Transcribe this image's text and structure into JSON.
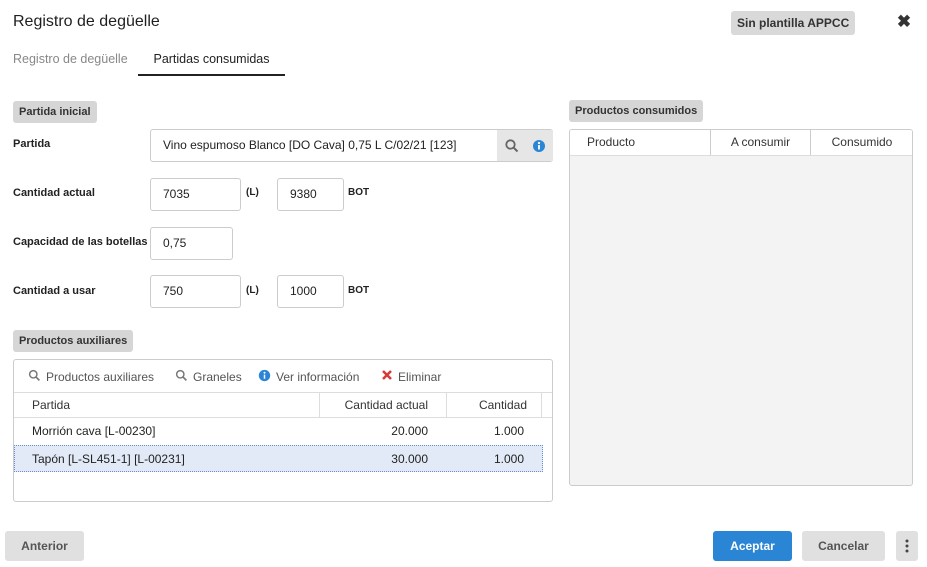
{
  "header": {
    "title": "Registro de degüelle",
    "template_badge": "Sin plantilla APPCC"
  },
  "tabs": [
    {
      "label": "Registro de degüelle"
    },
    {
      "label": "Partidas consumidas"
    }
  ],
  "partida_inicial": {
    "section_label": "Partida inicial",
    "partida_label": "Partida",
    "partida_value": "Vino espumoso Blanco [DO Cava] 0,75 L C/02/21 [123]",
    "cantidad_actual_label": "Cantidad actual",
    "cantidad_actual_l": "7035",
    "cantidad_actual_bot": "9380",
    "capacidad_label": "Capacidad de las botellas",
    "capacidad_value": "0,75",
    "cantidad_usar_label": "Cantidad a usar",
    "cantidad_usar_l": "750",
    "cantidad_usar_bot": "1000",
    "unit_l": "(L)",
    "unit_bot": "BOT"
  },
  "aux": {
    "section_label": "Productos auxiliares",
    "toolbar": {
      "productos_auxiliares": "Productos auxiliares",
      "graneles": "Graneles",
      "ver_informacion": "Ver información",
      "eliminar": "Eliminar"
    },
    "columns": [
      "Partida",
      "Cantidad actual",
      "Cantidad"
    ],
    "rows": [
      {
        "partida": "Morrión cava [L-00230]",
        "cantidad_actual": "20.000",
        "cantidad": "1.000"
      },
      {
        "partida": "Tapón [L-SL451-1] [L-00231]",
        "cantidad_actual": "30.000",
        "cantidad": "1.000"
      }
    ]
  },
  "consumidos": {
    "section_label": "Productos consumidos",
    "columns": [
      "Producto",
      "A consumir",
      "Consumido"
    ]
  },
  "footer": {
    "anterior": "Anterior",
    "aceptar": "Aceptar",
    "cancelar": "Cancelar"
  },
  "colors": {
    "accent": "#2a86d4",
    "delete": "#d63a3a",
    "info": "#2a86d4"
  }
}
